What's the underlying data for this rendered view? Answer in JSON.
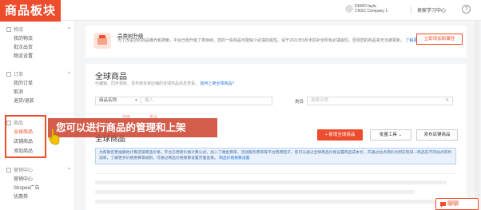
{
  "title_tag": "商品板块",
  "topbar": {
    "user_line1": "DEMO layla",
    "user_line2": "CNSC Company 1",
    "seller_center": "卖家学习中心"
  },
  "sidebar": {
    "groups": [
      {
        "label": "物流",
        "items": [
          "我的物流",
          "批次出货",
          "物流设置"
        ]
      },
      {
        "label": "订单",
        "items": [
          "我的订单",
          "取消",
          "退货/退款"
        ]
      },
      {
        "label": "商品",
        "items": [
          "全球商品",
          "店铺商品",
          "添加商品"
        ]
      },
      {
        "label": "营销中心",
        "items": [
          "营销中心",
          "Shopee广告",
          "优惠券"
        ]
      }
    ],
    "active_item": "全球商品"
  },
  "overlay_caption": "您可以进行商品的管理和上架",
  "notice": {
    "title": "品类树升级",
    "text": "为了改进您的商品曝光和搜索，平台已经升级了类目树。您的一些商品可能缺少必填的属性。请于2021年9月末前补全所有必填属性，否则您的商品将无法被更新。",
    "link": "了解更多",
    "button": "立即添加新属性"
  },
  "main": {
    "title": "全球商品",
    "subtitle": "可编辑、同步更新、发布到多家店铺的全球商品信息查看。",
    "subtitle_link": "如何上架全球商品?",
    "filter_select": "商品名称",
    "filter_placeholder": "输入",
    "category_label": "类目",
    "category_placeholder": "选择分类",
    "ghost_search": "搜索",
    "ghost_reset": "重设",
    "section_title": "全球商品",
    "btn_add": "+ 新增全球商品",
    "btn_bulk": "批量工具",
    "btn_publish": "发布店铺商品",
    "info_text": "为帮助您更准确地计算店铺商品价格，平台已更新价格计算公式，加入了佣金费率、活动服务费率等平台费用因子。您可以通过全球商品价格设置商品成本价，开通过站点调价比例实现同一商品在不同站点的利润率，了解更多价格换算等规则，可通过商品价格换算设置页面查看。",
    "info_link": "商品价格换算设置"
  },
  "chat_button": "聊聊",
  "colors": {
    "brand": "#ee4d2d",
    "link": "#2673dd",
    "info_bg": "#e8f1fc"
  }
}
